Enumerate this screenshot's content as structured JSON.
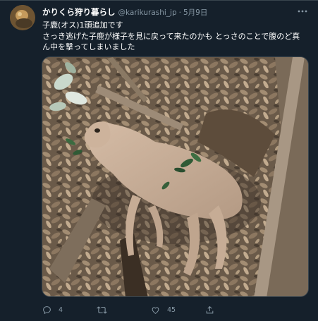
{
  "tweet": {
    "display_name": "かりくら狩り暮らし",
    "handle": "@karikurashi_jp",
    "separator": "·",
    "date": "5月9日",
    "text_lines": [
      "子鹿(オス)1頭追加です",
      "さっき逃げた子鹿が様子を見に戻って来たのかも とっさのことで腹のど真",
      "ん中を撃ってしまいました"
    ]
  },
  "media": {
    "alt": "photo of a young deer lying on dry leaves near fallen branches",
    "icon": "photo"
  },
  "actions": {
    "reply": {
      "icon": "reply-icon",
      "count": "4"
    },
    "retweet": {
      "icon": "retweet-icon",
      "count": ""
    },
    "like": {
      "icon": "like-icon",
      "count": "45"
    },
    "share": {
      "icon": "share-icon",
      "count": ""
    }
  },
  "colors": {
    "background": "#15202b",
    "border": "#38444d",
    "secondary_text": "#8899a6",
    "primary_text": "#ffffff"
  }
}
